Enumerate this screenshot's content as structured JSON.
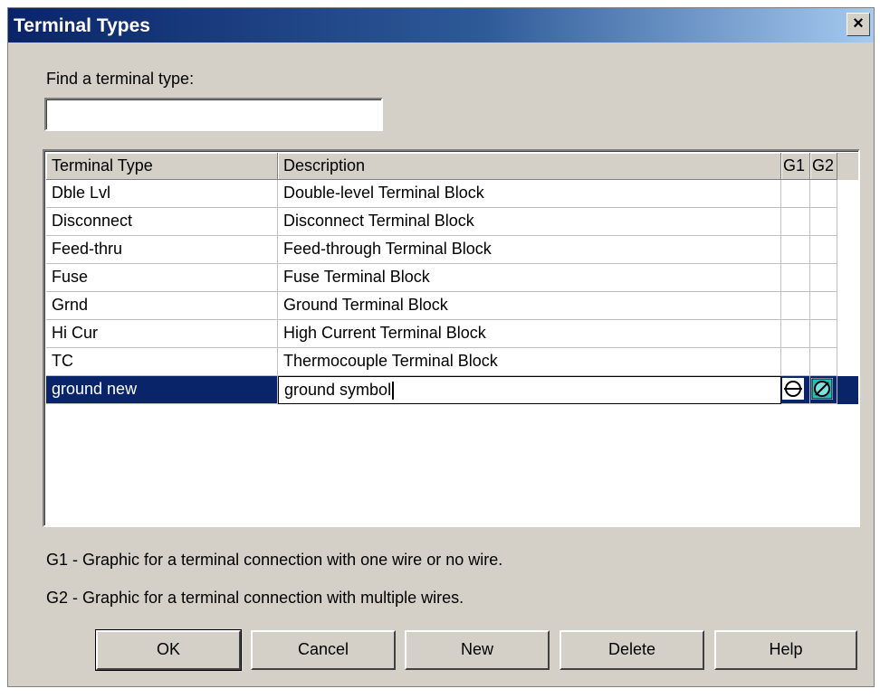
{
  "window": {
    "title": "Terminal Types",
    "close_symbol": "×"
  },
  "find": {
    "label": "Find a terminal type:",
    "value": ""
  },
  "table": {
    "columns": [
      "Terminal Type",
      "Description",
      "G1",
      "G2"
    ],
    "rows": [
      {
        "type": "Dble Lvl",
        "description": "Double-level Terminal Block"
      },
      {
        "type": "Disconnect",
        "description": "Disconnect Terminal Block"
      },
      {
        "type": "Feed-thru",
        "description": "Feed-through Terminal Block"
      },
      {
        "type": "Fuse",
        "description": "Fuse Terminal Block"
      },
      {
        "type": "Grnd",
        "description": "Ground Terminal Block"
      },
      {
        "type": "Hi Cur",
        "description": "High Current Terminal Block"
      },
      {
        "type": "TC",
        "description": "Thermocouple Terminal Block"
      },
      {
        "type": "ground new",
        "description": "ground symbol",
        "selected": true,
        "g1_icon": "terminal-one-wire-icon",
        "g2_icon": "terminal-multi-wire-icon"
      }
    ]
  },
  "notes": {
    "g1": "G1 - Graphic for a terminal connection with one wire or no wire.",
    "g2": "G2 - Graphic for a terminal connection with multiple wires."
  },
  "buttons": {
    "ok": "OK",
    "cancel": "Cancel",
    "new": "New",
    "delete": "Delete",
    "help": "Help"
  },
  "colors": {
    "title_start": "#0a246a",
    "title_end": "#a6caf0",
    "selection": "#0a246a",
    "face": "#d4d0c8",
    "g2_icon_fill": "#20c0c0"
  }
}
